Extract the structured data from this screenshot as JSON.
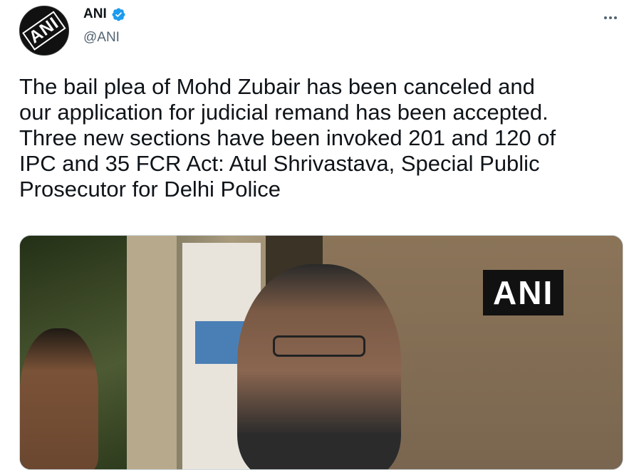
{
  "tweet": {
    "author_name": "ANI",
    "author_handle": "@ANI",
    "avatar_logo_text": "ANI",
    "text": "The bail plea of Mohd Zubair has been canceled and\nour application for judicial remand has been accepted.\nThree new sections have been invoked 201 and 120 of\nIPC and 35 FCR Act: Atul Shrivastava, Special Public\nProsecutor for Delhi Police"
  },
  "media": {
    "watermark_text": "ANI"
  },
  "icons": {
    "verified": "verified-badge-icon",
    "more": "more-options-icon"
  },
  "colors": {
    "verified_blue": "#1d9bf0",
    "text": "#0f1419",
    "secondary_text": "#536471"
  }
}
